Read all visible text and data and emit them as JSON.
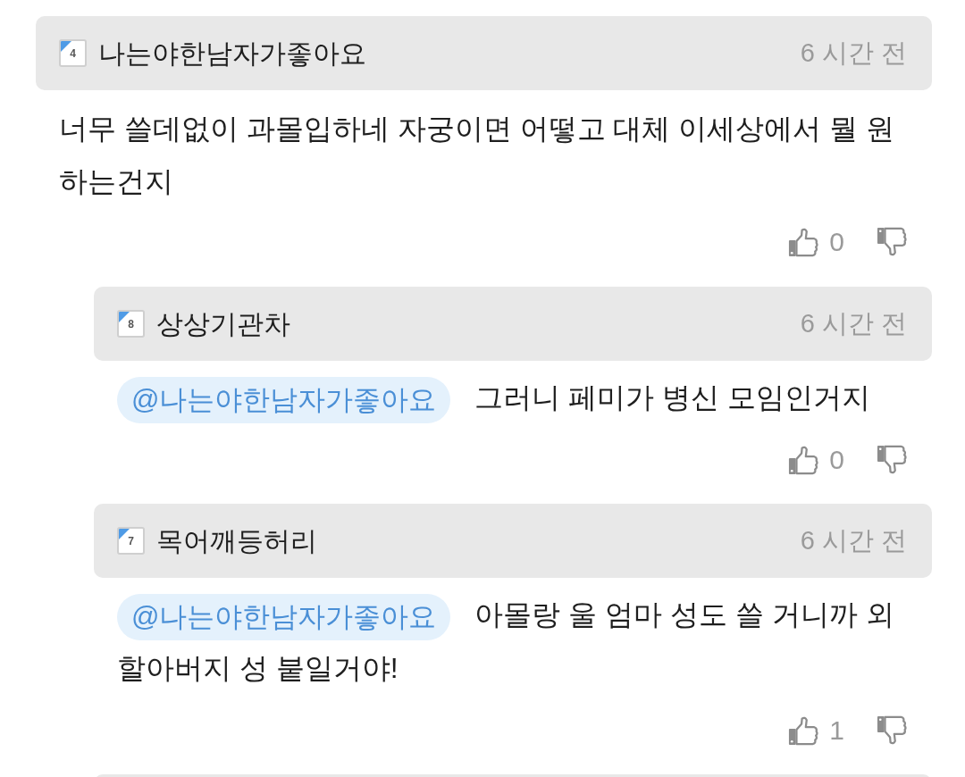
{
  "comment": {
    "badge": "4",
    "author": "나는야한남자가좋아요",
    "time": "6 시간 전",
    "text": "너무 쓸데없이 과몰입하네 자궁이면 어떻고 대체 이세상에서 뭘 원하는건지",
    "likes": "0"
  },
  "replies": [
    {
      "badge": "8",
      "author": "상상기관차",
      "time": "6 시간 전",
      "mention": "@나는야한남자가좋아요",
      "text": "그러니 페미가 병신 모임인거지",
      "likes": "0"
    },
    {
      "badge": "7",
      "author": "목어깨등허리",
      "time": "6 시간 전",
      "mention": "@나는야한남자가좋아요",
      "text": "아몰랑 울 엄마 성도 쓸 거니까 외할아버지 성 붙일거야!",
      "likes": "1"
    }
  ]
}
